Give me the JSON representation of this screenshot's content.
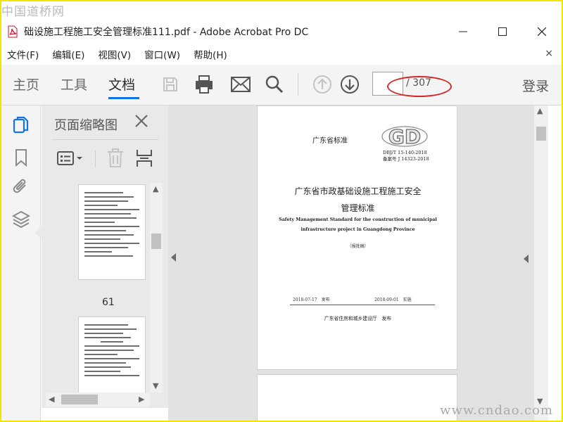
{
  "watermark": {
    "top": "中国道桥网",
    "bottom": "www.cndao.com"
  },
  "window": {
    "title": "础设施工程施工安全管理标准111.pdf - Adobe Acrobat Pro DC"
  },
  "menu": [
    "文件(F)",
    "编辑(E)",
    "视图(V)",
    "窗口(W)",
    "帮助(H)"
  ],
  "menu_close": "×",
  "toolbar": {
    "tabs": [
      "主页",
      "工具",
      "文档"
    ],
    "active_tab": "文档",
    "page_input": "",
    "page_total": "/ 307",
    "signin": "登录"
  },
  "thumbnail_panel": {
    "title": "页面缩略图",
    "page_number": "61"
  },
  "document": {
    "standard_label": "广东省标准",
    "logo_text": "GD",
    "code_line1": "DBJ/T 15-140-2018",
    "code_line2": "备案号 J 14323-2018",
    "title_line1": "广东省市政基础设施工程施工安全",
    "title_line2": "管理标准",
    "en_line1": "Safety Management Standard for the construction of municipal",
    "en_line2": "infrastructure project in Guangdong Province",
    "draft": "（报批稿）",
    "issue_date": "2018-07-17　发布",
    "effective_date": "2018-09-01　实施",
    "publisher": "广东省住房和城乡建设厅　发布"
  },
  "colors": {
    "accent": "#1473e6",
    "highlight": "#d62828",
    "frame": "#f2e600"
  }
}
